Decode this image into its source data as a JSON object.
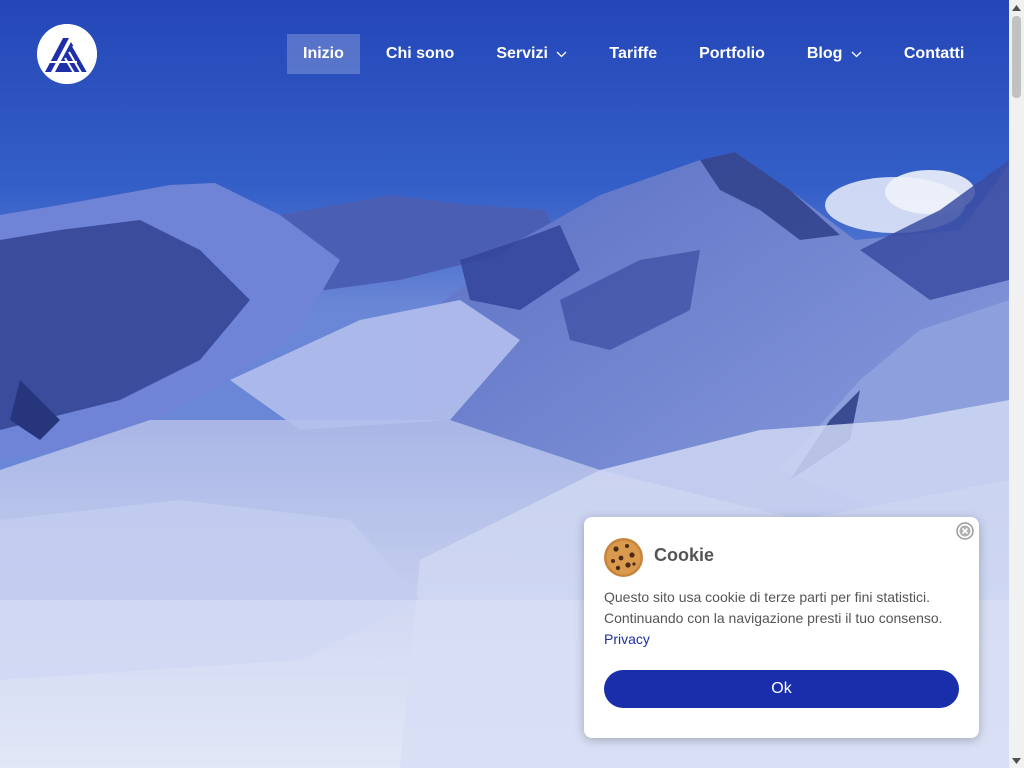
{
  "nav": {
    "items": [
      {
        "label": "Inizio"
      },
      {
        "label": "Chi sono"
      },
      {
        "label": "Servizi"
      },
      {
        "label": "Tariffe"
      },
      {
        "label": "Portfolio"
      },
      {
        "label": "Blog"
      },
      {
        "label": "Contatti"
      }
    ]
  },
  "cookie_banner": {
    "title": "Cookie",
    "text_line1": "Questo sito usa cookie di terze parti per fini statistici.",
    "text_line2": "Continuando con la navigazione presti il tuo consenso.",
    "privacy_link": "Privacy",
    "ok_label": "Ok"
  },
  "colors": {
    "accent": "#1a2eac",
    "link": "#1c2f9c",
    "nav_text": "#ffffff",
    "sky": "#2b4fc2"
  },
  "icons": {
    "logo": "mountain-logo-icon",
    "cookie": "cookie-icon",
    "close": "close-icon",
    "dropdown": "chevron-down-icon"
  }
}
